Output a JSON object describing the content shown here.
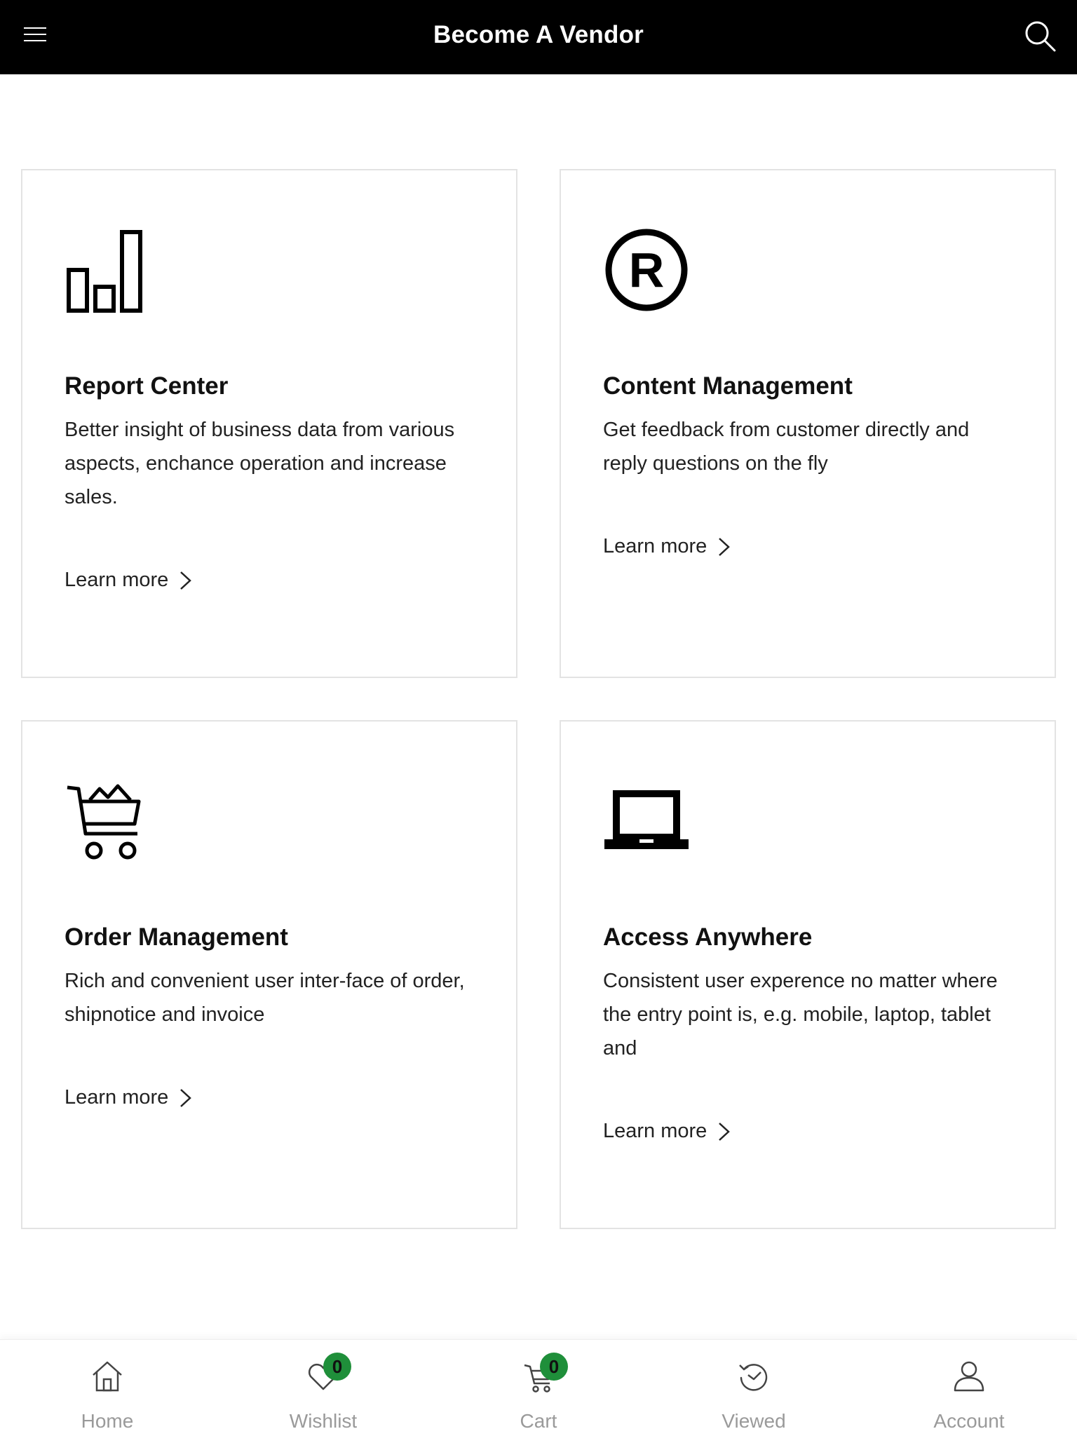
{
  "header": {
    "title": "Become A Vendor"
  },
  "features": [
    {
      "title": "Report Center",
      "description": "Better insight of business data from various aspects, enchance operation and increase sales.",
      "link": "Learn more",
      "icon": "bar-chart-icon"
    },
    {
      "title": "Content Management",
      "description": "Get feedback from customer directly and reply questions on the fly",
      "link": "Learn more",
      "icon": "registered-icon"
    },
    {
      "title": "Order Management",
      "description": "Rich and convenient user inter-face of order, shipnotice and invoice",
      "link": "Learn more",
      "icon": "shopping-cart-icon"
    },
    {
      "title": "Access Anywhere",
      "description": "Consistent user experence no matter where the entry point is, e.g. mobile, laptop, tablet and",
      "link": "Learn more",
      "icon": "laptop-icon"
    }
  ],
  "bottom_nav": {
    "items": [
      {
        "label": "Home",
        "icon": "home-icon"
      },
      {
        "label": "Wishlist",
        "icon": "heart-icon",
        "badge": "0"
      },
      {
        "label": "Cart",
        "icon": "cart-icon",
        "badge": "0"
      },
      {
        "label": "Viewed",
        "icon": "history-icon"
      },
      {
        "label": "Account",
        "icon": "user-icon"
      }
    ]
  },
  "colors": {
    "header_bg": "#000000",
    "badge": "#1f8f3a",
    "nav_label": "#9a9a9a",
    "card_border": "#e3e3e3"
  }
}
